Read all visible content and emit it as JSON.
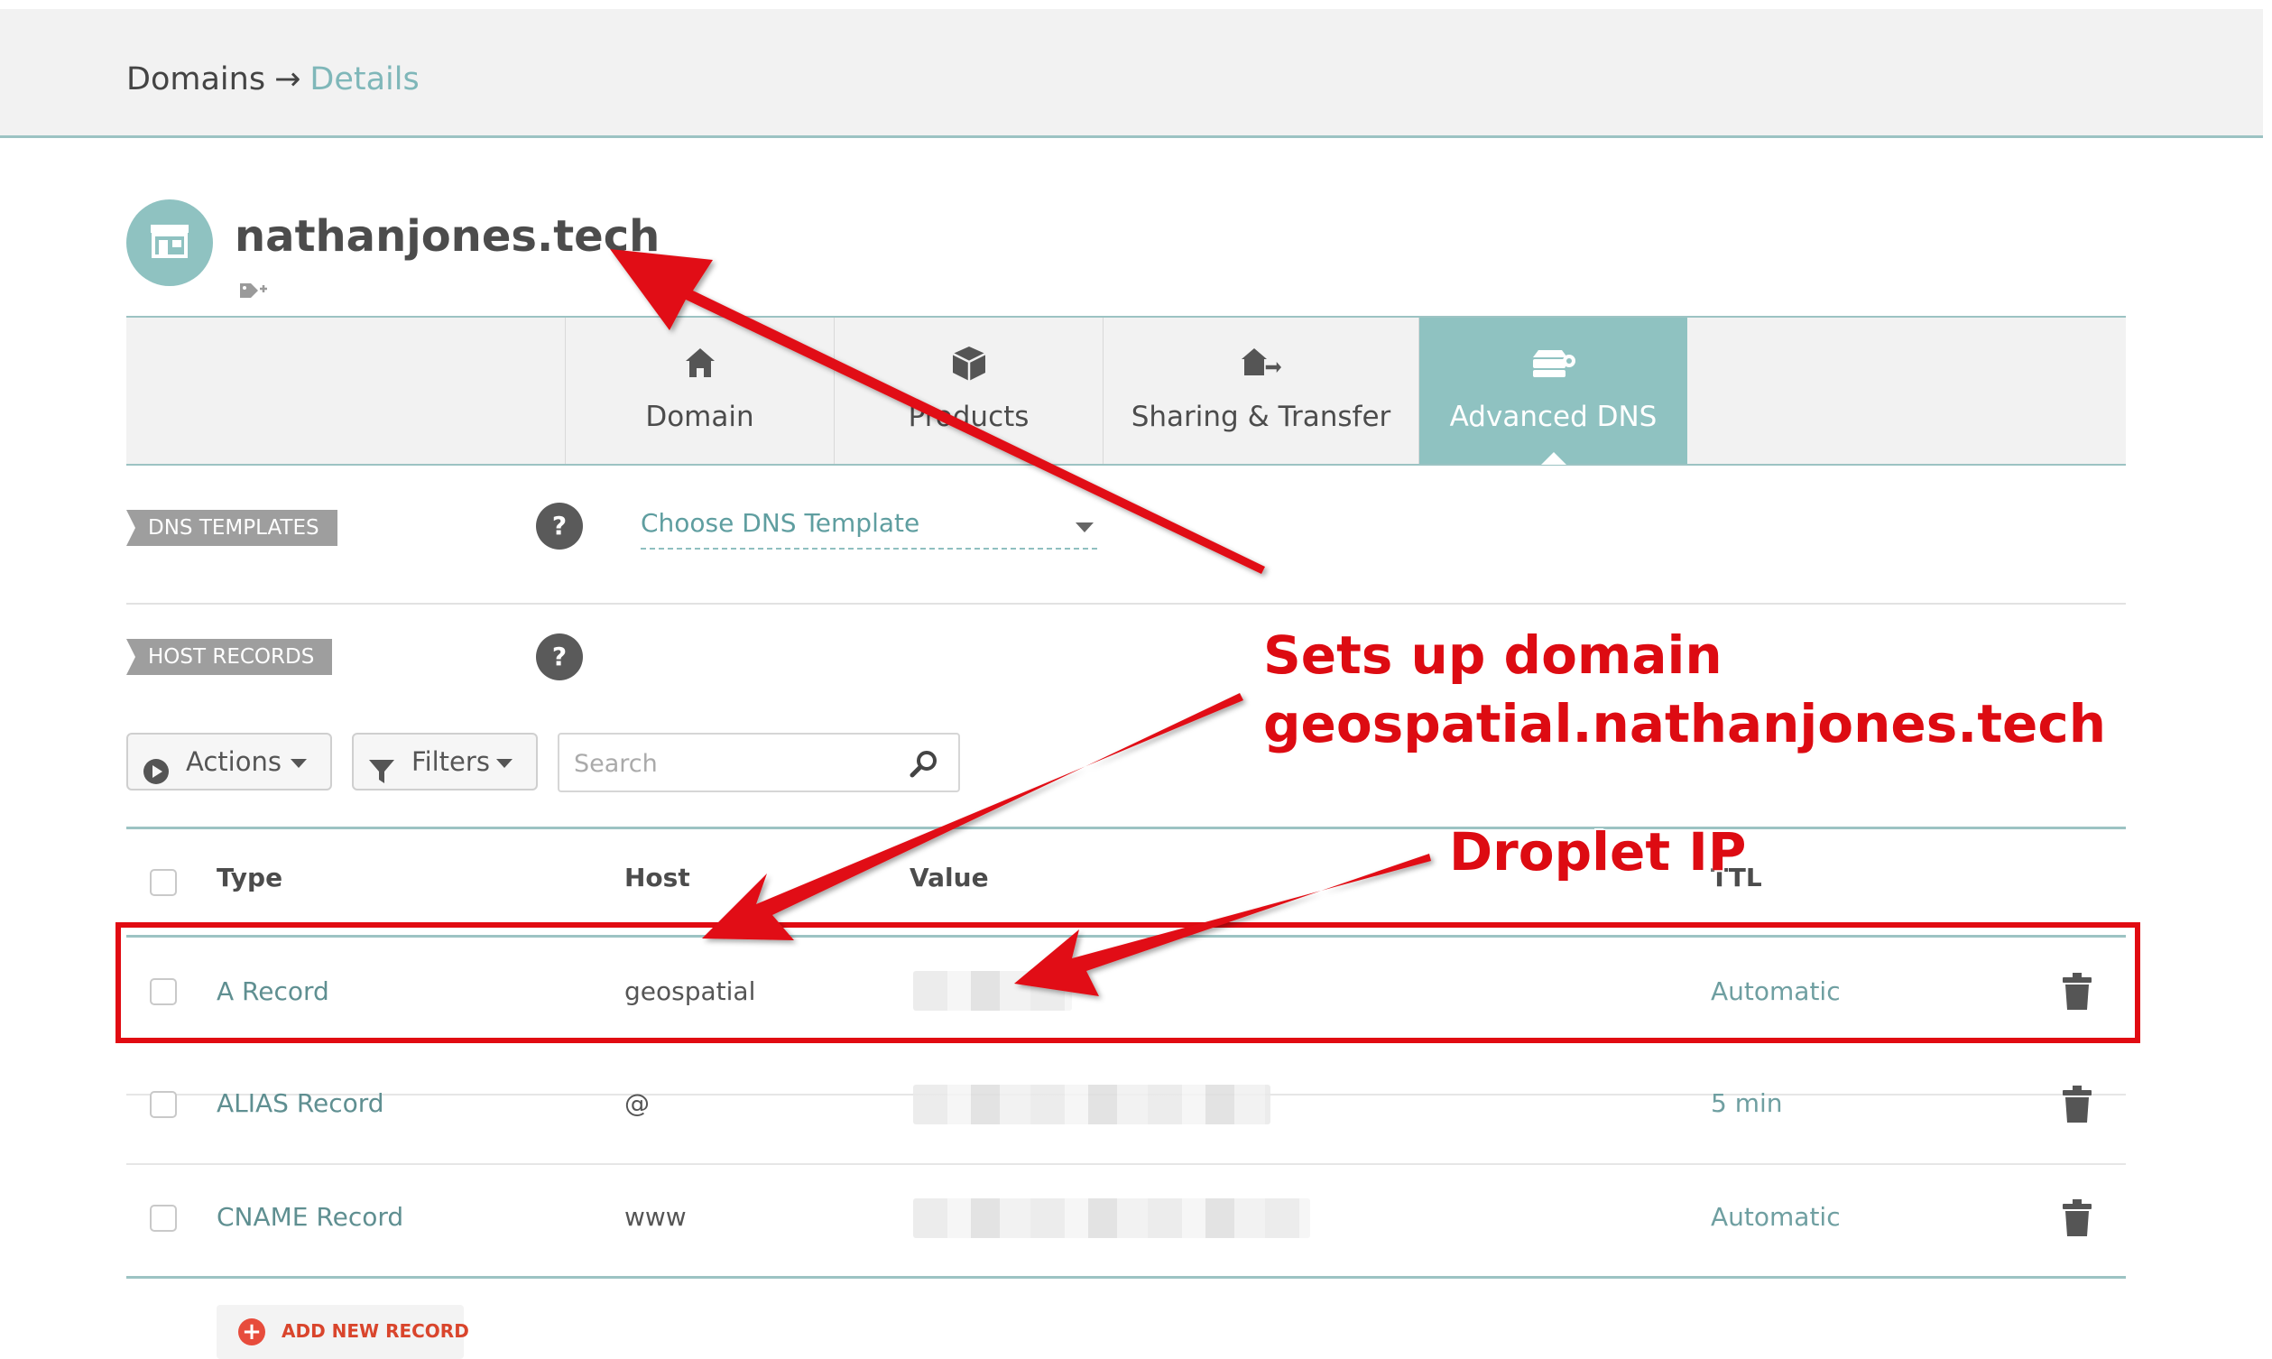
{
  "breadcrumb": {
    "root": "Domains",
    "separator": "→",
    "current": "Details"
  },
  "domain": {
    "name": "nathanjones.tech",
    "icon": "storefront-icon",
    "tag_icon": "add-tag-icon"
  },
  "tabs": [
    {
      "label": "Domain",
      "icon": "home-icon"
    },
    {
      "label": "Products",
      "icon": "box-icon"
    },
    {
      "label": "Sharing & Transfer",
      "icon": "transfer-icon"
    },
    {
      "label": "Advanced DNS",
      "icon": "server-icon",
      "active": true
    }
  ],
  "dns_templates": {
    "label": "DNS TEMPLATES",
    "help": "?",
    "select_placeholder": "Choose DNS Template"
  },
  "host_records": {
    "label": "HOST RECORDS",
    "help": "?",
    "actions_label": "Actions",
    "filters_label": "Filters",
    "search_placeholder": "Search",
    "columns": {
      "type": "Type",
      "host": "Host",
      "value": "Value",
      "ttl": "TTL"
    },
    "rows": [
      {
        "type": "A Record",
        "host": "geospatial",
        "value": "",
        "ttl": "Automatic"
      },
      {
        "type": "ALIAS Record",
        "host": "@",
        "value": "",
        "ttl": "5 min"
      },
      {
        "type": "CNAME Record",
        "host": "www",
        "value": "",
        "ttl": "Automatic"
      }
    ],
    "add_label": "ADD NEW RECORD"
  },
  "annotations": {
    "sets_up_line1": "Sets up domain",
    "sets_up_line2": "geospatial.nathanjones.tech",
    "droplet": "Droplet IP"
  },
  "colors": {
    "accent": "#8fc2c1",
    "annotation_red": "#e10b12",
    "add_red": "#e74c3c"
  }
}
